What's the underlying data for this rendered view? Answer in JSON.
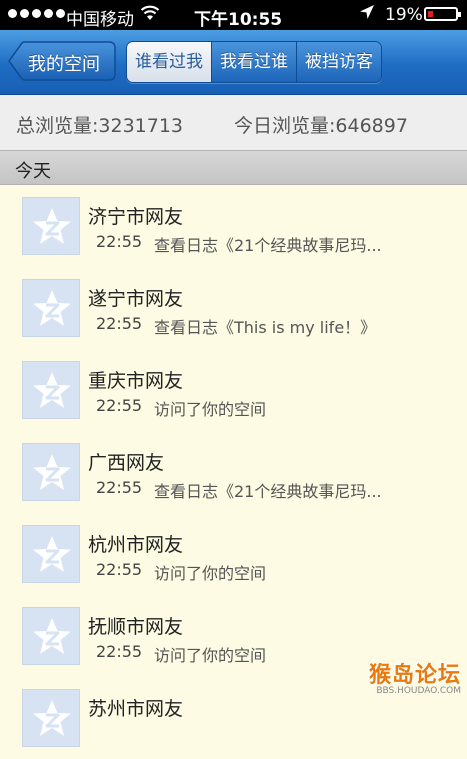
{
  "status_bar": {
    "carrier": "中国移动",
    "time": "下午10:55",
    "battery_pct": "19%",
    "battery_level": 0.19,
    "icons": [
      "signal-dots",
      "wifi-icon",
      "location-arrow-icon",
      "battery-icon"
    ]
  },
  "navbar": {
    "back_label": "我的空间",
    "tabs": [
      {
        "label": "谁看过我",
        "active": true
      },
      {
        "label": "我看过谁",
        "active": false
      },
      {
        "label": "被挡访客",
        "active": false
      }
    ],
    "colors": {
      "bar": "#1f6dc4",
      "active_tab_text": "#2b5e9a"
    }
  },
  "stats": {
    "total": "总浏览量:3231713",
    "today": "今日浏览量:646897"
  },
  "section": {
    "title": "今天"
  },
  "visitors": [
    {
      "name": "济宁市网友",
      "time": "22:55",
      "action": "查看日志《21个经典故事尼玛..."
    },
    {
      "name": "遂宁市网友",
      "time": "22:55",
      "action": "查看日志《This is my life！》"
    },
    {
      "name": "重庆市网友",
      "time": "22:55",
      "action": "访问了你的空间"
    },
    {
      "name": "广西网友",
      "time": "22:55",
      "action": "查看日志《21个经典故事尼玛..."
    },
    {
      "name": "杭州市网友",
      "time": "22:55",
      "action": "访问了你的空间"
    },
    {
      "name": "抚顺市网友",
      "time": "22:55",
      "action": "访问了你的空间"
    },
    {
      "name": "苏州市网友",
      "time": "",
      "action": ""
    }
  ],
  "watermark": {
    "title": "猴岛论坛",
    "url": "BBS.HOUDAO.COM"
  }
}
